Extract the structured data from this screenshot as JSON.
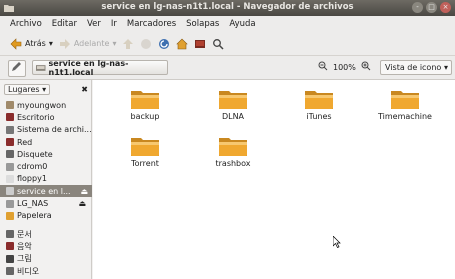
{
  "window": {
    "title": "service en lg-nas-n1t1.local - Navegador de archivos",
    "controls": [
      "-",
      "□",
      "×"
    ]
  },
  "menubar": [
    "Archivo",
    "Editar",
    "Ver",
    "Ir",
    "Marcadores",
    "Solapas",
    "Ayuda"
  ],
  "toolbar": {
    "back": "Atrás",
    "forward": "Adelante"
  },
  "location": {
    "crumb": "service en lg-nas-n1t1.local",
    "zoom": "100%",
    "view": "Vista de icono"
  },
  "sidebar": {
    "header": "Lugares",
    "items": [
      {
        "label": "myoungwon",
        "icon": "home-icon",
        "color": "#a08a6a"
      },
      {
        "label": "Escritorio",
        "icon": "desktop-icon",
        "color": "#8a2c2c"
      },
      {
        "label": "Sistema de archi...",
        "icon": "filesystem-icon",
        "color": "#777777"
      },
      {
        "label": "Red",
        "icon": "network-icon",
        "color": "#8a2c2c"
      },
      {
        "label": "Disquete",
        "icon": "floppy-icon",
        "color": "#666666"
      },
      {
        "label": "cdrom0",
        "icon": "cdrom-icon",
        "color": "#999999"
      },
      {
        "label": "floppy1",
        "icon": "floppy-icon",
        "color": "#dddddd"
      },
      {
        "label": "service en l...",
        "icon": "network-share-icon",
        "color": "#cccccc",
        "selected": true,
        "eject": true
      },
      {
        "label": "LG_NAS",
        "icon": "cdrom-icon",
        "color": "#999999",
        "eject": true
      },
      {
        "label": "Papelera",
        "icon": "trash-icon",
        "color": "#e0a030"
      },
      {
        "label": "문서",
        "icon": "documents-icon",
        "color": "#666666"
      },
      {
        "label": "음악",
        "icon": "music-icon",
        "color": "#8a2c2c"
      },
      {
        "label": "그림",
        "icon": "pictures-icon",
        "color": "#444444"
      },
      {
        "label": "비디오",
        "icon": "videos-icon",
        "color": "#666666"
      }
    ]
  },
  "folders": [
    {
      "name": "backup"
    },
    {
      "name": "DLNA"
    },
    {
      "name": "iTunes"
    },
    {
      "name": "Timemachine"
    },
    {
      "name": "Torrent"
    },
    {
      "name": "trashbox"
    }
  ],
  "colors": {
    "folder": "#f0a830",
    "titlebar": "#4a4843",
    "selection": "#8a857d"
  }
}
